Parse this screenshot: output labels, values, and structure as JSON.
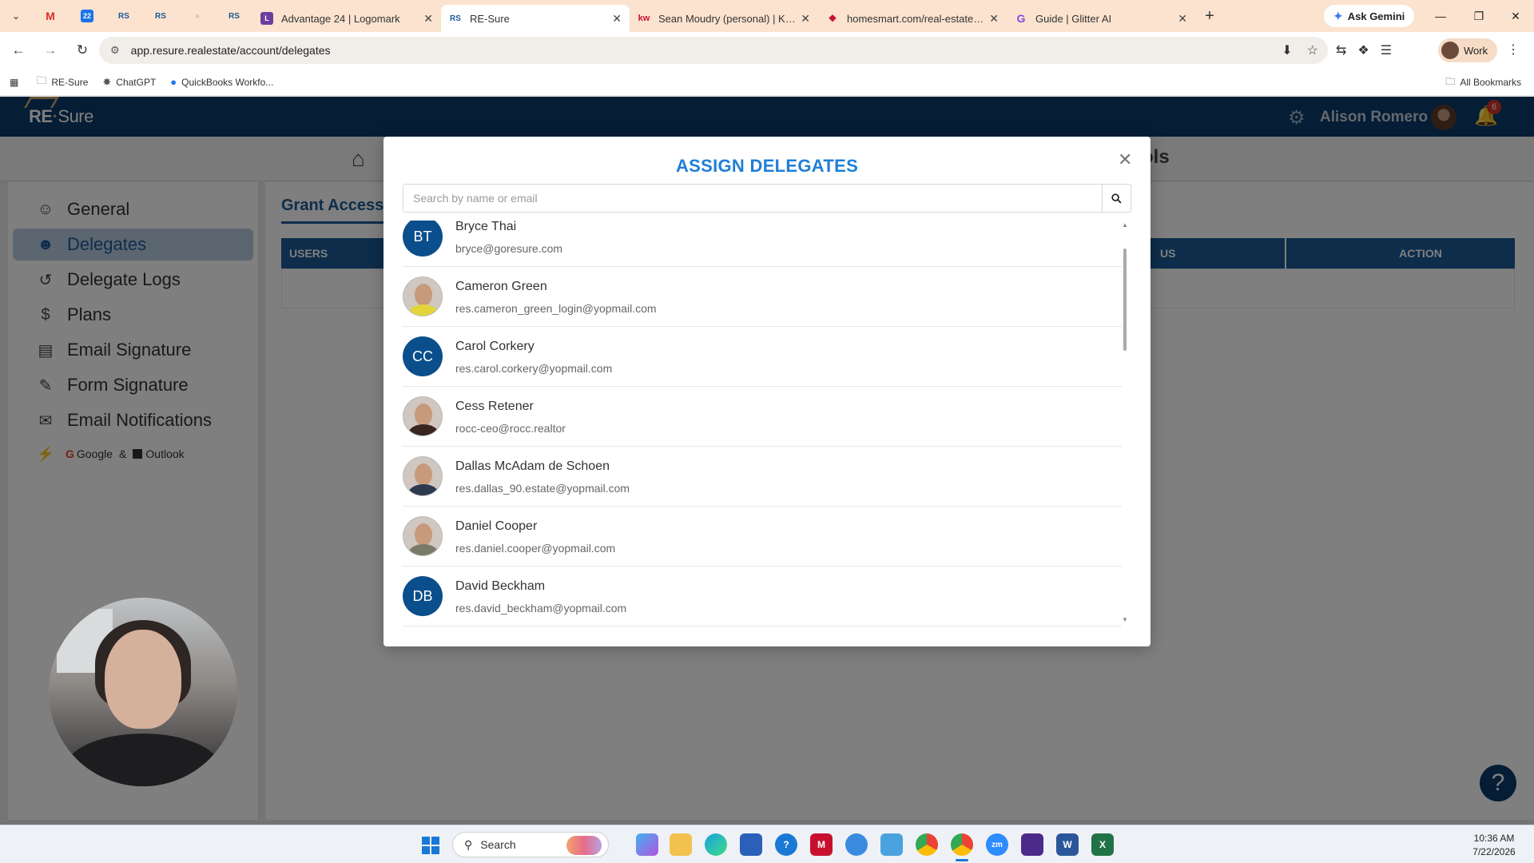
{
  "browser": {
    "tabs": [
      {
        "title": "Advantage 24 | Logomark",
        "active": false
      },
      {
        "title": "RE-Sure",
        "active": true
      },
      {
        "title": "Sean Moudry (personal) | Keller",
        "active": false
      },
      {
        "title": "homesmart.com/real-estate-ag",
        "active": false
      },
      {
        "title": "Guide | Glitter AI",
        "active": false
      }
    ],
    "pinned_rs_label": "RS",
    "gemini_label": "Ask Gemini",
    "url": "app.resure.realestate/account/delegates",
    "profile_label": "Work",
    "bookmarks": [
      "RE-Sure",
      "ChatGPT",
      "QuickBooks Workfo..."
    ],
    "all_bookmarks": "All Bookmarks"
  },
  "app": {
    "logo_re": "RE",
    "logo_sure": "Sure",
    "user_name": "Alison Romero",
    "notification_count": "6",
    "nav_tools_partial": "ols",
    "sidebar": [
      {
        "label": "General",
        "icon": "user-icon"
      },
      {
        "label": "Delegates",
        "icon": "users-icon",
        "active": true
      },
      {
        "label": "Delegate Logs",
        "icon": "logs-icon"
      },
      {
        "label": "Plans",
        "icon": "dollar-icon"
      },
      {
        "label": "Email Signature",
        "icon": "id-card-icon"
      },
      {
        "label": "Form Signature",
        "icon": "signature-icon"
      },
      {
        "label": "Email Notifications",
        "icon": "mail-icon"
      }
    ],
    "integrations": {
      "google": "Google",
      "amp": "&",
      "outlook": "Outlook"
    },
    "main": {
      "tab_label": "Grant Access",
      "col_users": "USERS",
      "col_status_partial": "US",
      "col_action": "ACTION"
    }
  },
  "modal": {
    "title": "ASSIGN DELEGATES",
    "search_placeholder": "Search by name or email",
    "users": [
      {
        "name": "Bryce Thai",
        "email": "bryce@goresure.com",
        "initials": "BT",
        "photo": false
      },
      {
        "name": "Cameron Green",
        "email": "res.cameron_green_login@yopmail.com",
        "initials": "",
        "photo": true,
        "shirt": "#e3d43a"
      },
      {
        "name": "Carol Corkery",
        "email": "res.carol.corkery@yopmail.com",
        "initials": "CC",
        "photo": false
      },
      {
        "name": "Cess Retener",
        "email": "rocc-ceo@rocc.realtor",
        "initials": "",
        "photo": true,
        "shirt": "#3a2420"
      },
      {
        "name": "Dallas McAdam de Schoen",
        "email": "res.dallas_90.estate@yopmail.com",
        "initials": "",
        "photo": true,
        "shirt": "#2d3a4e"
      },
      {
        "name": "Daniel Cooper",
        "email": "res.daniel.cooper@yopmail.com",
        "initials": "",
        "photo": true,
        "shirt": "#7a7a6a"
      },
      {
        "name": "David Beckham",
        "email": "res.david_beckham@yopmail.com",
        "initials": "DB",
        "photo": false
      }
    ]
  },
  "taskbar": {
    "search_label": "Search",
    "time": "10:36 AM",
    "date": "7/22/2026"
  },
  "colors": {
    "brand_navy": "#0b3b6a",
    "brand_blue": "#1a5a96",
    "modal_title": "#1e7fd8",
    "tab_strip": "#fbe3cf"
  }
}
